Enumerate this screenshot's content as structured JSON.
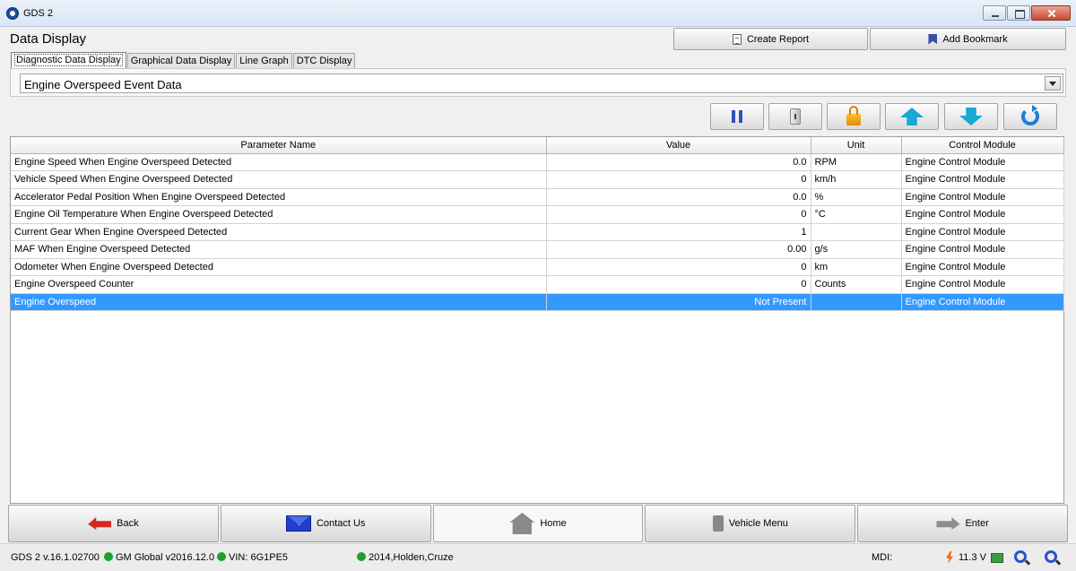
{
  "window": {
    "title": "GDS 2"
  },
  "header": {
    "page_title": "Data Display",
    "create_report_label": "Create Report",
    "add_bookmark_label": "Add Bookmark"
  },
  "tabs": [
    {
      "label": "Diagnostic Data Display",
      "active": true
    },
    {
      "label": "Graphical Data Display",
      "active": false
    },
    {
      "label": "Line Graph",
      "active": false
    },
    {
      "label": "DTC Display",
      "active": false
    }
  ],
  "data_list_select": {
    "selected": "Engine Overspeed Event Data"
  },
  "toolbar": {
    "icons": [
      "pause-icon",
      "hold-icon",
      "lock-icon",
      "arrow-up-icon",
      "arrow-down-icon",
      "refresh-icon"
    ]
  },
  "table": {
    "columns": [
      "Parameter Name",
      "Value",
      "Unit",
      "Control Module"
    ],
    "rows": [
      {
        "name": "Engine Speed When Engine Overspeed Detected",
        "value": "0.0",
        "unit": "RPM",
        "module": "Engine Control Module"
      },
      {
        "name": "Vehicle Speed When Engine Overspeed Detected",
        "value": "0",
        "unit": "km/h",
        "module": "Engine Control Module"
      },
      {
        "name": "Accelerator Pedal Position When Engine Overspeed Detected",
        "value": "0.0",
        "unit": "%",
        "module": "Engine Control Module"
      },
      {
        "name": "Engine Oil Temperature When Engine Overspeed Detected",
        "value": "0",
        "unit": "°C",
        "module": "Engine Control Module"
      },
      {
        "name": "Current Gear When Engine Overspeed Detected",
        "value": "1",
        "unit": "",
        "module": "Engine Control Module"
      },
      {
        "name": "MAF When Engine Overspeed Detected",
        "value": "0.00",
        "unit": "g/s",
        "module": "Engine Control Module"
      },
      {
        "name": "Odometer When Engine Overspeed Detected",
        "value": "0",
        "unit": "km",
        "module": "Engine Control Module"
      },
      {
        "name": "Engine Overspeed Counter",
        "value": "0",
        "unit": "Counts",
        "module": "Engine Control Module"
      },
      {
        "name": "Engine Overspeed",
        "value": "Not Present",
        "unit": "",
        "module": "Engine Control Module",
        "selected": true
      }
    ]
  },
  "nav": {
    "back_label": "Back",
    "contact_label": "Contact Us",
    "home_label": "Home",
    "vehicle_menu_label": "Vehicle Menu",
    "enter_label": "Enter"
  },
  "status": {
    "version": "GDS 2 v.16.1.02700",
    "global": "GM Global v2016.12.0",
    "vin": "VIN: 6G1PE5",
    "vehicle": "2014,Holden,Cruze",
    "mdi_label": "MDI:",
    "voltage": "11.3 V",
    "status_color": "#1f9f2a",
    "selection_color": "#3399ff"
  }
}
